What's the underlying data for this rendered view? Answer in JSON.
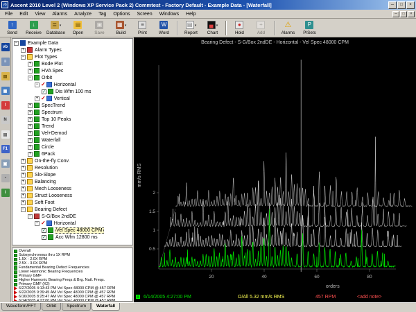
{
  "titlebar": {
    "title": "Ascent 2010 Level 2  (Windows XP Service Pack 2) Commtest - Factory Default - Example Data - [Waterfall]"
  },
  "menubar": {
    "items": [
      "File",
      "Edit",
      "View",
      "Alarms",
      "Analyze",
      "Tag",
      "Options",
      "Screen",
      "Windows",
      "Help"
    ]
  },
  "toolbar": {
    "buttons": [
      {
        "label": "Send",
        "icon": "send"
      },
      {
        "label": "Receive",
        "icon": "receive"
      },
      {
        "label": "Database",
        "icon": "database",
        "dropdown": true
      },
      {
        "label": "Open",
        "icon": "open"
      },
      {
        "label": "Save",
        "icon": "save",
        "disabled": true
      },
      {
        "label": "Build",
        "icon": "build",
        "dropdown": true
      },
      {
        "label": "Print",
        "icon": "print"
      },
      {
        "label": "Word",
        "icon": "word"
      },
      {
        "sep": true
      },
      {
        "label": "Report",
        "icon": "report",
        "dropdown": true
      },
      {
        "label": "Chart",
        "icon": "chart",
        "dropdown": true
      },
      {
        "sep": true
      },
      {
        "label": "Hold",
        "icon": "hold"
      },
      {
        "label": "Add",
        "icon": "add",
        "disabled": true
      },
      {
        "sep": true
      },
      {
        "label": "Alarms",
        "icon": "alarms"
      },
      {
        "label": "P/Sets",
        "icon": "psets"
      }
    ]
  },
  "left_rail": {
    "icons": [
      {
        "name": "vb-logo-icon",
        "glyph": "vb",
        "bg": "#16469e",
        "fg": "#ffffff"
      },
      {
        "name": "hierarchy-icon",
        "glyph": "≡",
        "bg": "#7a93b8",
        "fg": "#ffffff"
      },
      {
        "name": "folder-icon",
        "glyph": "▤",
        "bg": "#d9b34a",
        "fg": "#6b4e00"
      },
      {
        "name": "chart-icon",
        "glyph": "▦",
        "bg": "#4a7fc1",
        "fg": "#ffffff"
      },
      {
        "name": "alarm-icon",
        "glyph": "!",
        "bg": "#d43b3b",
        "fg": "#ffffff"
      },
      {
        "name": "notes-icon",
        "glyph": "N",
        "bg": "#c9c9c9",
        "fg": "#333333"
      },
      {
        "name": "report-icon",
        "glyph": "▤",
        "bg": "#e6e6e6",
        "fg": "#555555"
      },
      {
        "name": "f1-help-icon",
        "glyph": "F1",
        "bg": "#3f64c8",
        "fg": "#ffffff"
      },
      {
        "name": "machine-icon",
        "glyph": "▣",
        "bg": "#8aa0b8",
        "fg": "#ffffff"
      },
      {
        "name": "gauge-icon",
        "glyph": "◔",
        "bg": "#b0b0b0",
        "fg": "#222222"
      },
      {
        "name": "info-icon",
        "glyph": "i",
        "bg": "#3f8f3f",
        "fg": "#ffffff"
      }
    ]
  },
  "tree": {
    "items": [
      {
        "label": "Example Data",
        "depth": 0,
        "exp": "minus",
        "icon": "vb"
      },
      {
        "label": "Alarm Types",
        "depth": 1,
        "exp": "plus",
        "icon": "alarm"
      },
      {
        "label": "Plot Types",
        "depth": 1,
        "exp": "minus",
        "icon": "folder"
      },
      {
        "label": "Bode Plot",
        "depth": 2,
        "exp": "plus",
        "icon": "green"
      },
      {
        "label": "HVA Spec",
        "depth": 2,
        "exp": "plus",
        "icon": "green"
      },
      {
        "label": "Orbit",
        "depth": 2,
        "exp": "minus",
        "icon": "green"
      },
      {
        "label": "Horizontal",
        "depth": 3,
        "exp": "minus",
        "check": "mark",
        "icon": "blue"
      },
      {
        "label": "Dis Wfm 100 ms",
        "depth": 4,
        "exp": "none",
        "check": "box",
        "icon": "green"
      },
      {
        "label": "Vertical",
        "depth": 3,
        "exp": "plus",
        "check": "mark",
        "icon": "blue"
      },
      {
        "label": "SpecTrend",
        "depth": 2,
        "exp": "plus",
        "icon": "green"
      },
      {
        "label": "Spectrum",
        "depth": 2,
        "exp": "plus",
        "icon": "green"
      },
      {
        "label": "Top 10 Peaks",
        "depth": 2,
        "exp": "plus",
        "icon": "green"
      },
      {
        "label": "Trend",
        "depth": 2,
        "exp": "plus",
        "icon": "green"
      },
      {
        "label": "Vel+Demod",
        "depth": 2,
        "exp": "plus",
        "icon": "green"
      },
      {
        "label": "Waterfall",
        "depth": 2,
        "exp": "plus",
        "icon": "green"
      },
      {
        "label": "Circle",
        "depth": 2,
        "exp": "plus",
        "icon": "green"
      },
      {
        "label": "6Pack",
        "depth": 2,
        "exp": "plus",
        "icon": "green"
      },
      {
        "label": "On-the-fly Conv.",
        "depth": 1,
        "exp": "plus",
        "icon": "folder"
      },
      {
        "label": "Resolution",
        "depth": 1,
        "exp": "plus",
        "icon": "folder"
      },
      {
        "label": "Slo-Slope",
        "depth": 1,
        "exp": "plus",
        "icon": "folder"
      },
      {
        "label": "Balancing",
        "depth": 1,
        "exp": "plus",
        "icon": "folder"
      },
      {
        "label": "Mech Looseness",
        "depth": 1,
        "exp": "plus",
        "icon": "folder"
      },
      {
        "label": "Struct Looseness",
        "depth": 1,
        "exp": "plus",
        "icon": "folder"
      },
      {
        "label": "Soft Foot",
        "depth": 1,
        "exp": "plus",
        "icon": "folder"
      },
      {
        "label": "Bearing Defect",
        "depth": 1,
        "exp": "minus",
        "icon": "folder"
      },
      {
        "label": "S-G/Box 2ndDE",
        "depth": 2,
        "exp": "minus",
        "icon": "machine"
      },
      {
        "label": "Horizontal",
        "depth": 3,
        "exp": "minus",
        "check": "mark",
        "icon": "blue"
      },
      {
        "label": "Vel Spec 48000 CPM",
        "depth": 4,
        "exp": "none",
        "check": "box",
        "icon": "green",
        "selected": true
      },
      {
        "label": "Acc Wfm 12800 ms",
        "depth": 4,
        "exp": "none",
        "check": "box",
        "icon": "green"
      }
    ]
  },
  "bands": {
    "items": [
      {
        "label": "Overall",
        "icon": "band"
      },
      {
        "label": "Subsynchronous thru 1X RPM",
        "icon": "band"
      },
      {
        "label": "1.5X - 2.0X RPM",
        "icon": "band"
      },
      {
        "label": "2.5X - 3.0X RPM",
        "icon": "band"
      },
      {
        "label": "Fundamental Bearing Defect Frequencies",
        "icon": "band"
      },
      {
        "label": "Lower Harmonic Bearing Frequencies",
        "icon": "band"
      },
      {
        "label": "Primary GMF",
        "icon": "band"
      },
      {
        "label": "Higher Harmonic Bearing Freqs & Brg. Natl. Freqs.",
        "icon": "band"
      },
      {
        "label": "Primary GMF (X2)",
        "icon": "band"
      },
      {
        "label": "6/27/2005 4:13:43 PM Vel Spec 48000 CPM @ 457 RPM",
        "icon": "recording"
      },
      {
        "label": "6/22/2005 9:39:45 AM Vel Spec 48000 CPM @ 457 RPM",
        "icon": "recording"
      },
      {
        "label": "6/16/2005 8:25:47 AM Vel Spec 48000 CPM @ 457 RPM",
        "icon": "recording"
      },
      {
        "label": "6/14/2005 4:27:00 PM Vel Spec 48000 CPM @ 457 RPM",
        "icon": "recording"
      }
    ]
  },
  "tabs": {
    "items": [
      {
        "label": "Waveform/FFT",
        "active": false
      },
      {
        "label": "Orbit",
        "active": false
      },
      {
        "label": "Spectrum",
        "active": false
      },
      {
        "label": "Waterfall",
        "active": true
      }
    ]
  },
  "chart_data": {
    "type": "line",
    "variant": "waterfall-spectra",
    "title": "Bearing Defect - S-G/Box 2ndDE - Horizontal - Vel Spec 48000 CPM",
    "xlabel": "orders",
    "ylabel": "mm/s RMS",
    "xlim": [
      0,
      90
    ],
    "ylim": [
      0,
      2.2
    ],
    "xticks": [
      20,
      40,
      60,
      80
    ],
    "yticks": [
      0.5,
      1,
      1.5,
      2
    ],
    "grid": false,
    "legend": "none",
    "cursor_order": 54,
    "background": "#000000",
    "peaks_orders_amplitude": [
      [
        1,
        0.3
      ],
      [
        2.1,
        0.18
      ],
      [
        3.1,
        0.22
      ],
      [
        4.2,
        0.5
      ],
      [
        5.2,
        0.2
      ],
      [
        6.3,
        0.28
      ],
      [
        7.4,
        0.2
      ],
      [
        8.4,
        0.42
      ],
      [
        9.5,
        0.22
      ],
      [
        10.5,
        0.3
      ],
      [
        11.6,
        0.24
      ],
      [
        12.6,
        0.5
      ],
      [
        13.7,
        0.25
      ],
      [
        14.7,
        0.3
      ],
      [
        15.8,
        0.28
      ],
      [
        16.8,
        0.38
      ],
      [
        18,
        0.3
      ],
      [
        19,
        0.33
      ],
      [
        20,
        0.28
      ],
      [
        21,
        0.5
      ],
      [
        22,
        0.75
      ],
      [
        23,
        0.45
      ],
      [
        24.1,
        0.35
      ],
      [
        25.2,
        0.6
      ],
      [
        26.2,
        0.4
      ],
      [
        27.3,
        0.38
      ],
      [
        28.3,
        0.45
      ],
      [
        29.4,
        0.55
      ],
      [
        30.4,
        0.5
      ],
      [
        31.5,
        0.8
      ],
      [
        32.5,
        0.6
      ],
      [
        33.6,
        1.25
      ],
      [
        34.6,
        0.55
      ],
      [
        35.7,
        0.65
      ],
      [
        36.7,
        0.5
      ],
      [
        37.8,
        0.7
      ],
      [
        38.8,
        0.55
      ],
      [
        39.9,
        0.75
      ],
      [
        40.9,
        0.6
      ],
      [
        42,
        1.85
      ],
      [
        43,
        0.7
      ],
      [
        44.1,
        0.9
      ],
      [
        45.1,
        0.6
      ],
      [
        46.2,
        0.7
      ],
      [
        47.2,
        0.55
      ],
      [
        48.3,
        0.75
      ],
      [
        49.3,
        0.5
      ],
      [
        50.4,
        0.6
      ],
      [
        52.5,
        0.85
      ],
      [
        54.6,
        1.4
      ],
      [
        56.7,
        0.75
      ],
      [
        58.8,
        0.55
      ],
      [
        61,
        0.8
      ],
      [
        63,
        0.5
      ],
      [
        65,
        0.55
      ],
      [
        67,
        0.4
      ],
      [
        69,
        0.5
      ],
      [
        71,
        0.55
      ],
      [
        73,
        0.4
      ],
      [
        75,
        0.45
      ],
      [
        77,
        0.8
      ],
      [
        79,
        0.5
      ],
      [
        81,
        0.45
      ],
      [
        83,
        0.5
      ],
      [
        85,
        0.45
      ],
      [
        87,
        0.35
      ]
    ],
    "series": [
      {
        "name": "6/14/2005 4:27:00 PM",
        "color": "#00dd00",
        "spikes": []
      },
      {
        "name": "6/16/2005 8:25:47 AM",
        "color": "#e8e8e8",
        "spikes": []
      },
      {
        "name": "6/22/2005 9:39:45 AM",
        "color": "#dadada",
        "spikes": [
          [
            78,
            2.4
          ]
        ]
      },
      {
        "name": "6/27/2005 4:13:43 PM",
        "color": "#cccccc",
        "spikes": []
      }
    ],
    "status": {
      "timestamp": "6/14/2005 4:27:00 PM",
      "overall": "O/All 5.32 mm/s RMS",
      "rpm": "457 RPM",
      "note": "<add note>"
    }
  }
}
